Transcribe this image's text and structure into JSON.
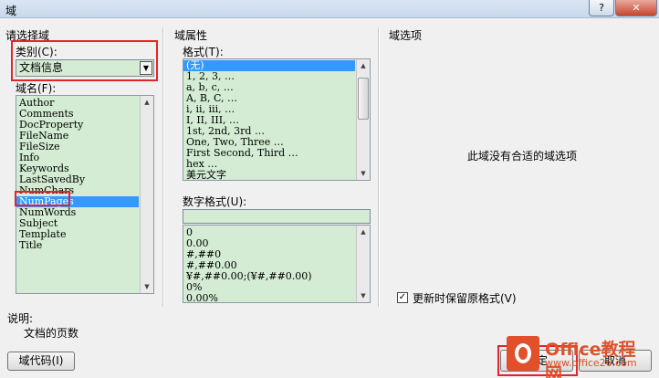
{
  "window": {
    "title": "域",
    "help": "?",
    "close": "✕"
  },
  "left": {
    "group_label": "请选择域",
    "category_label": "类别(C):",
    "category_value": "文档信息",
    "fieldname_label": "域名(F):",
    "field_names": [
      "Author",
      "Comments",
      "DocProperty",
      "FileName",
      "FileSize",
      "Info",
      "Keywords",
      "LastSavedBy",
      "NumChars",
      "NumPages",
      "NumWords",
      "Subject",
      "Template",
      "Title"
    ],
    "selected_field": "NumPages"
  },
  "middle": {
    "group_label": "域属性",
    "format_label": "格式(T):",
    "formats": [
      "(无)",
      "1, 2, 3, …",
      "a, b, c, …",
      "A, B, C, …",
      "i, ii, iii, …",
      "I, II, III, …",
      "1st, 2nd, 3rd …",
      "One, Two, Three …",
      "First Second, Third …",
      "hex …",
      "美元文字"
    ],
    "selected_format": "(无)",
    "number_format_label": "数字格式(U):",
    "number_format_value": "",
    "number_formats": [
      "0",
      "0.00",
      "#,##0",
      "#,##0.00",
      "¥#,##0.00;(¥#,##0.00)",
      "0%",
      "0.00%"
    ]
  },
  "right": {
    "group_label": "域选项",
    "no_options_text": "此域没有合适的域选项",
    "preserve_format_label": "更新时保留原格式(V)",
    "preserve_format_checked": true
  },
  "description": {
    "label": "说明:",
    "text": "文档的页数"
  },
  "buttons": {
    "field_codes": "域代码(I)",
    "ok": "确定",
    "cancel": "取消"
  },
  "watermark": {
    "brand": "Office教程网",
    "url": "www.office26.com"
  }
}
